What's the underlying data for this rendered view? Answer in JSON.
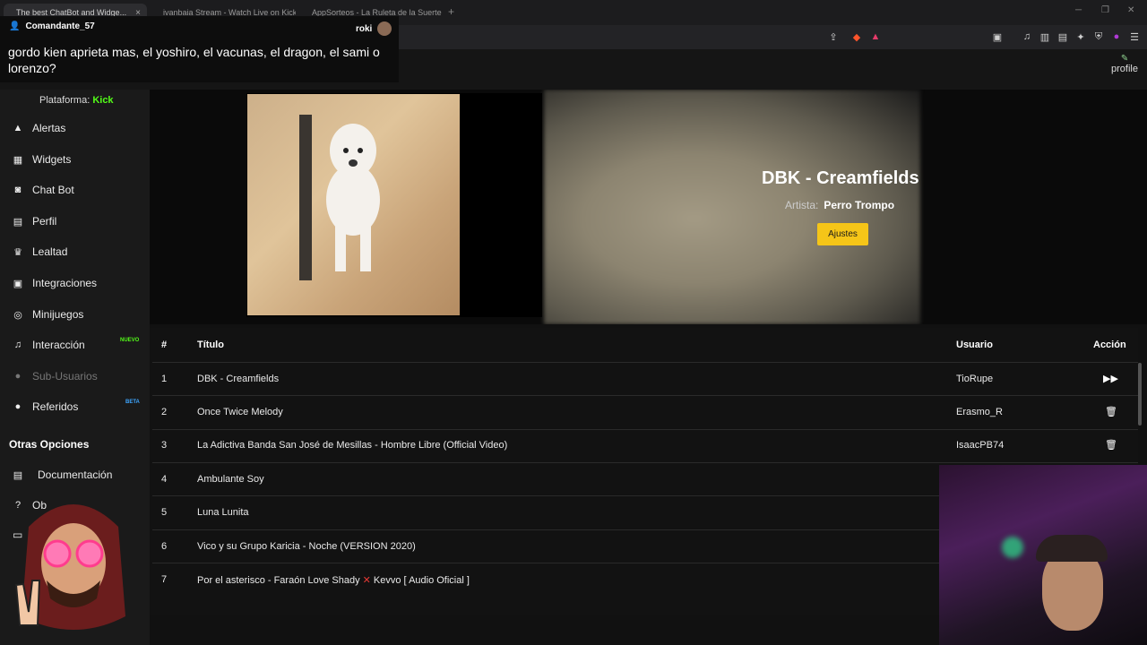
{
  "browser": {
    "tabs": [
      {
        "label": "The best ChatBot and Widge..."
      },
      {
        "label": "ivanbaia Stream - Watch Live on Kick"
      },
      {
        "label": "AppSorteos - La Ruleta de la Suerte"
      }
    ],
    "new_tab": "+"
  },
  "header": {
    "profile_label": "profile"
  },
  "chat": {
    "username": "Comandante_57",
    "streamer": "roki",
    "message": "gordo kien aprieta mas, el yoshiro, el vacunas, el dragon, el sami o lorenzo?"
  },
  "sidebar": {
    "platform_label": "Plataforma:",
    "platform_value": "Kick",
    "items": [
      {
        "label": "Alertas",
        "icon": "warning-icon"
      },
      {
        "label": "Widgets",
        "icon": "grid-icon"
      },
      {
        "label": "Chat Bot",
        "icon": "robot-icon"
      },
      {
        "label": "Perfil",
        "icon": "id-card-icon"
      },
      {
        "label": "Lealtad",
        "icon": "trophy-icon"
      },
      {
        "label": "Integraciones",
        "icon": "plug-icon"
      },
      {
        "label": "Minijuegos",
        "icon": "gamepad-icon"
      },
      {
        "label": "Interacción",
        "icon": "music-icon",
        "badge": "NUEVO"
      },
      {
        "label": "Sub-Usuarios",
        "icon": "users-icon"
      },
      {
        "label": "Referidos",
        "icon": "user-group-icon",
        "badge": "BETA"
      }
    ],
    "section_title": "Otras Opciones",
    "other": [
      {
        "label": "Documentación",
        "icon": "book-icon"
      },
      {
        "label": "Ob",
        "icon": "help-icon"
      }
    ]
  },
  "now_playing": {
    "title": "DBK - Creamfields",
    "artist_label": "Artista:",
    "artist": "Perro Trompo",
    "settings_button": "Ajustes"
  },
  "queue": {
    "headers": {
      "num": "#",
      "title": "Título",
      "user": "Usuario",
      "action": "Acción"
    },
    "rows": [
      {
        "num": "1",
        "title": "DBK - Creamfields",
        "user": "TioRupe",
        "action": "skip"
      },
      {
        "num": "2",
        "title": "Once Twice Melody",
        "user": "Erasmo_R",
        "action": "delete"
      },
      {
        "num": "3",
        "title": "La Adictiva Banda San José de Mesillas - Hombre Libre (Official Video)",
        "user": "IsaacPB74",
        "action": "delete"
      },
      {
        "num": "4",
        "title": "Ambulante Soy",
        "user": "",
        "action": ""
      },
      {
        "num": "5",
        "title": "Luna Lunita",
        "user": "",
        "action": ""
      },
      {
        "num": "6",
        "title": "Vico y su Grupo Karicia - Noche (VERSION 2020)",
        "user": "",
        "action": ""
      },
      {
        "num": "7",
        "title_a": "Por el asterisco - Faraón Love Shady ",
        "title_x": "✕",
        "title_b": " Kevvo [ Audio Oficial ]",
        "user": "",
        "action": ""
      }
    ]
  },
  "colors": {
    "kick_green": "#53fc18",
    "accent_yellow": "#f5c518",
    "beta_blue": "#3ea6ff"
  }
}
